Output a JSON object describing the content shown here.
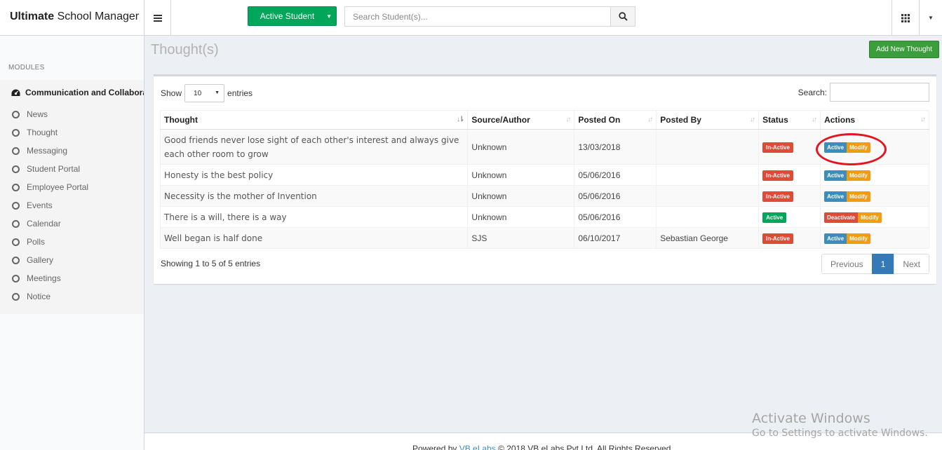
{
  "app": {
    "logo_bold": "Ultimate",
    "logo_rest": " School Manager"
  },
  "header": {
    "active_student_label": "Active Student",
    "search_placeholder": "Search Student(s)..."
  },
  "sidebar": {
    "modules_label": "MODULES",
    "parent_label": "Communication and Collaborat",
    "items": [
      {
        "label": "News"
      },
      {
        "label": "Thought"
      },
      {
        "label": "Messaging"
      },
      {
        "label": "Student Portal"
      },
      {
        "label": "Employee Portal"
      },
      {
        "label": "Events"
      },
      {
        "label": "Calendar"
      },
      {
        "label": "Polls"
      },
      {
        "label": "Gallery"
      },
      {
        "label": "Meetings"
      },
      {
        "label": "Notice"
      }
    ]
  },
  "page": {
    "title": "Thought(s)",
    "add_button": "Add New Thought"
  },
  "table_controls": {
    "show_label": "Show",
    "entries_value": "10",
    "entries_label": "entries",
    "search_label": "Search:"
  },
  "table": {
    "columns": [
      "Thought",
      "Source/Author",
      "Posted On",
      "Posted By",
      "Status",
      "Actions"
    ],
    "rows": [
      {
        "thought": "Good friends never lose sight of each other's interest and always give each other room to grow",
        "author": "Unknown",
        "posted_on": "13/03/2018",
        "posted_by": "",
        "status": "In-Active",
        "action1": "Active",
        "action2": "Modify"
      },
      {
        "thought": "Honesty is the best policy",
        "author": "Unknown",
        "posted_on": "05/06/2016",
        "posted_by": "",
        "status": "In-Active",
        "action1": "Active",
        "action2": "Modify"
      },
      {
        "thought": "Necessity is the mother of Invention",
        "author": "Unknown",
        "posted_on": "05/06/2016",
        "posted_by": "",
        "status": "In-Active",
        "action1": "Active",
        "action2": "Modify"
      },
      {
        "thought": "There is a will, there is a way",
        "author": "Unknown",
        "posted_on": "05/06/2016",
        "posted_by": "",
        "status": "Active",
        "action1": "Deactivate",
        "action2": "Modify"
      },
      {
        "thought": "Well began is half done",
        "author": "SJS",
        "posted_on": "06/10/2017",
        "posted_by": "Sebastian George",
        "status": "In-Active",
        "action1": "Active",
        "action2": "Modify"
      }
    ]
  },
  "pagination": {
    "info": "Showing 1 to 5 of 5 entries",
    "previous": "Previous",
    "current": "1",
    "next": "Next"
  },
  "footer": {
    "powered_by": "Powered by ",
    "brand": "VB eLabs",
    "copyright": " © 2018 VB eLabs Pvt Ltd. All Rights Reserved."
  },
  "watermark": {
    "line1": "Activate Windows",
    "line2": "Go to Settings to activate Windows."
  },
  "colors": {
    "primary": "#3c8dbc",
    "success": "#00a65a",
    "danger": "#dd4b39",
    "warning": "#f39c12",
    "annotation": "#e3141f"
  }
}
